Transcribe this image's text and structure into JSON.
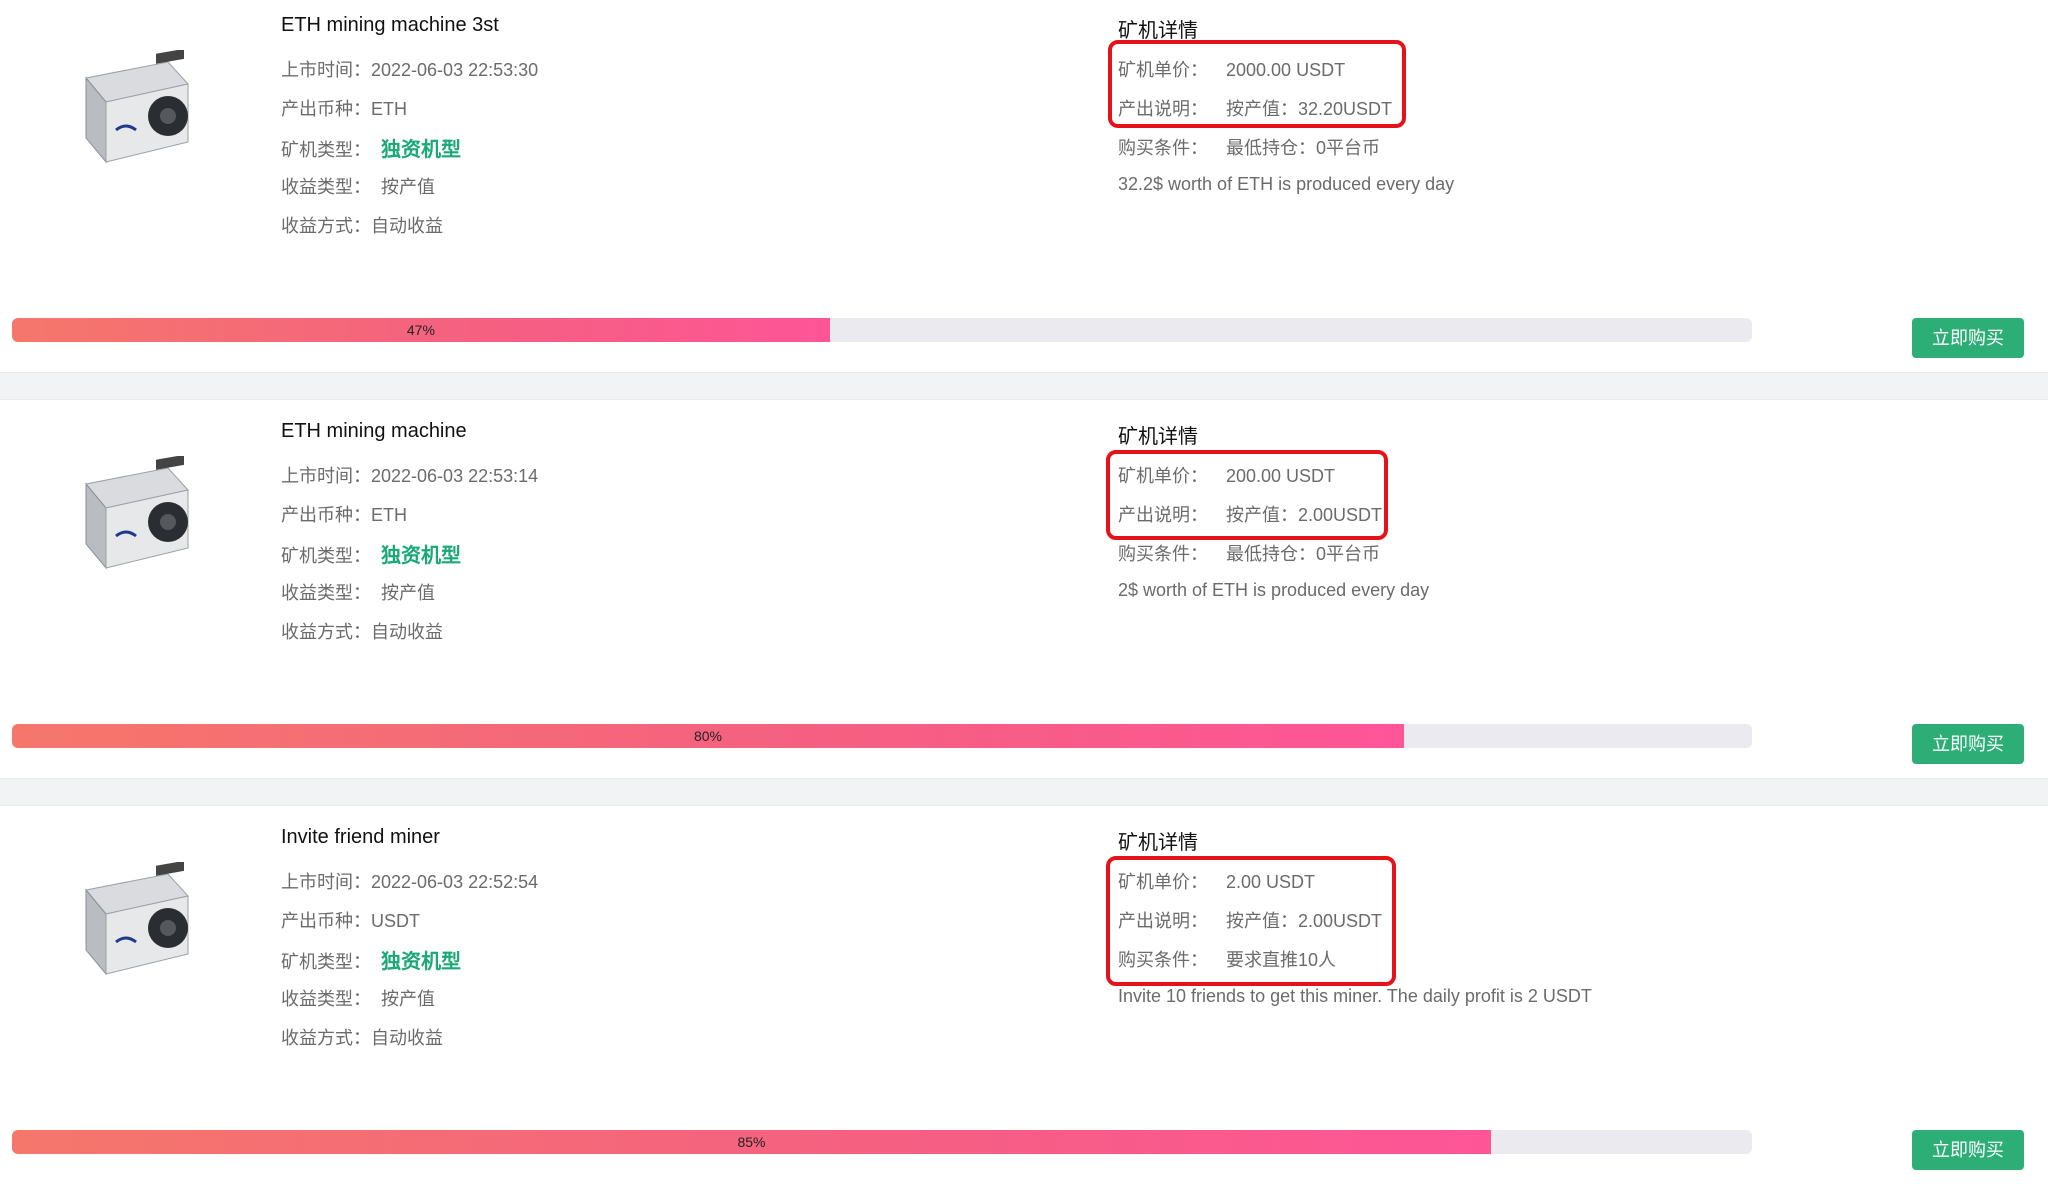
{
  "products": [
    {
      "title": "ETH mining machine 3st",
      "listing": {
        "label": "上市时间：",
        "value": "2022-06-03 22:53:30"
      },
      "coin": {
        "label": "产出币种：",
        "value": "ETH"
      },
      "miner_type": {
        "label": "矿机类型：",
        "value": "独资机型"
      },
      "income_type": {
        "label": "收益类型：",
        "value": "按产值"
      },
      "income_method": {
        "label": "收益方式：",
        "value": "自动收益"
      },
      "details_title": "矿机详情",
      "price": {
        "label": "矿机单价：",
        "value": "2000.00 USDT"
      },
      "output": {
        "label": "产出说明：",
        "value": "按产值：32.20USDT"
      },
      "condition": {
        "label": "购买条件：",
        "value": "最低持仓：0平台币"
      },
      "note": "32.2$ worth of ETH is produced every day",
      "progress": 47,
      "progress_label": "47%",
      "buy_label": "立即购买"
    },
    {
      "title": "ETH mining machine",
      "listing": {
        "label": "上市时间：",
        "value": "2022-06-03 22:53:14"
      },
      "coin": {
        "label": "产出币种：",
        "value": "ETH"
      },
      "miner_type": {
        "label": "矿机类型：",
        "value": "独资机型"
      },
      "income_type": {
        "label": "收益类型：",
        "value": "按产值"
      },
      "income_method": {
        "label": "收益方式：",
        "value": "自动收益"
      },
      "details_title": "矿机详情",
      "price": {
        "label": "矿机单价：",
        "value": "200.00 USDT"
      },
      "output": {
        "label": "产出说明：",
        "value": "按产值：2.00USDT"
      },
      "condition": {
        "label": "购买条件：",
        "value": "最低持仓：0平台币"
      },
      "note": "2$ worth of ETH is produced every day",
      "progress": 80,
      "progress_label": "80%",
      "buy_label": "立即购买"
    },
    {
      "title": "Invite friend miner",
      "listing": {
        "label": "上市时间：",
        "value": "2022-06-03 22:52:54"
      },
      "coin": {
        "label": "产出币种：",
        "value": "USDT"
      },
      "miner_type": {
        "label": "矿机类型：",
        "value": "独资机型"
      },
      "income_type": {
        "label": "收益类型：",
        "value": "按产值"
      },
      "income_method": {
        "label": "收益方式：",
        "value": "自动收益"
      },
      "details_title": "矿机详情",
      "price": {
        "label": "矿机单价：",
        "value": "2.00 USDT"
      },
      "output": {
        "label": "产出说明：",
        "value": "按产值：2.00USDT"
      },
      "condition": {
        "label": "购买条件：",
        "value": "要求直推10人"
      },
      "note": "Invite 10 friends to get this miner. The daily profit is 2 USDT",
      "progress": 85,
      "progress_label": "85%",
      "buy_label": "立即购买"
    }
  ],
  "colors": {
    "accent_green": "#19a974",
    "buy_button": "#2dae77",
    "highlight_box": "#e6121a",
    "progress_start": "#f5776b",
    "progress_end": "#fe5597"
  }
}
